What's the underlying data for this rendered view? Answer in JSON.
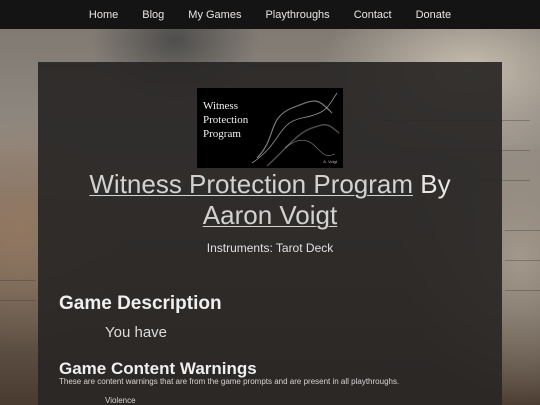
{
  "nav": {
    "items": [
      "Home",
      "Blog",
      "My Games",
      "Playthroughs",
      "Contact",
      "Donate"
    ]
  },
  "cover": {
    "title_lines": [
      "Witness",
      "Protection",
      "Program"
    ],
    "author": "A. Voigt"
  },
  "game": {
    "title": "Witness Protection Program",
    "by": "By",
    "author": "Aaron Voigt",
    "instruments": "Instruments: Tarot Deck"
  },
  "description": {
    "heading": "Game Description",
    "text": "You have"
  },
  "warnings": {
    "heading": "Game Content Warnings",
    "subtitle": "These are content warnings that are from the game prompts and are present in all playthroughs.",
    "items": [
      "Violence"
    ]
  },
  "colors": {
    "nav_bg": "#151414",
    "panel_bg": "#282625",
    "link": "#d2d2d2",
    "text": "#e7e7e7"
  }
}
